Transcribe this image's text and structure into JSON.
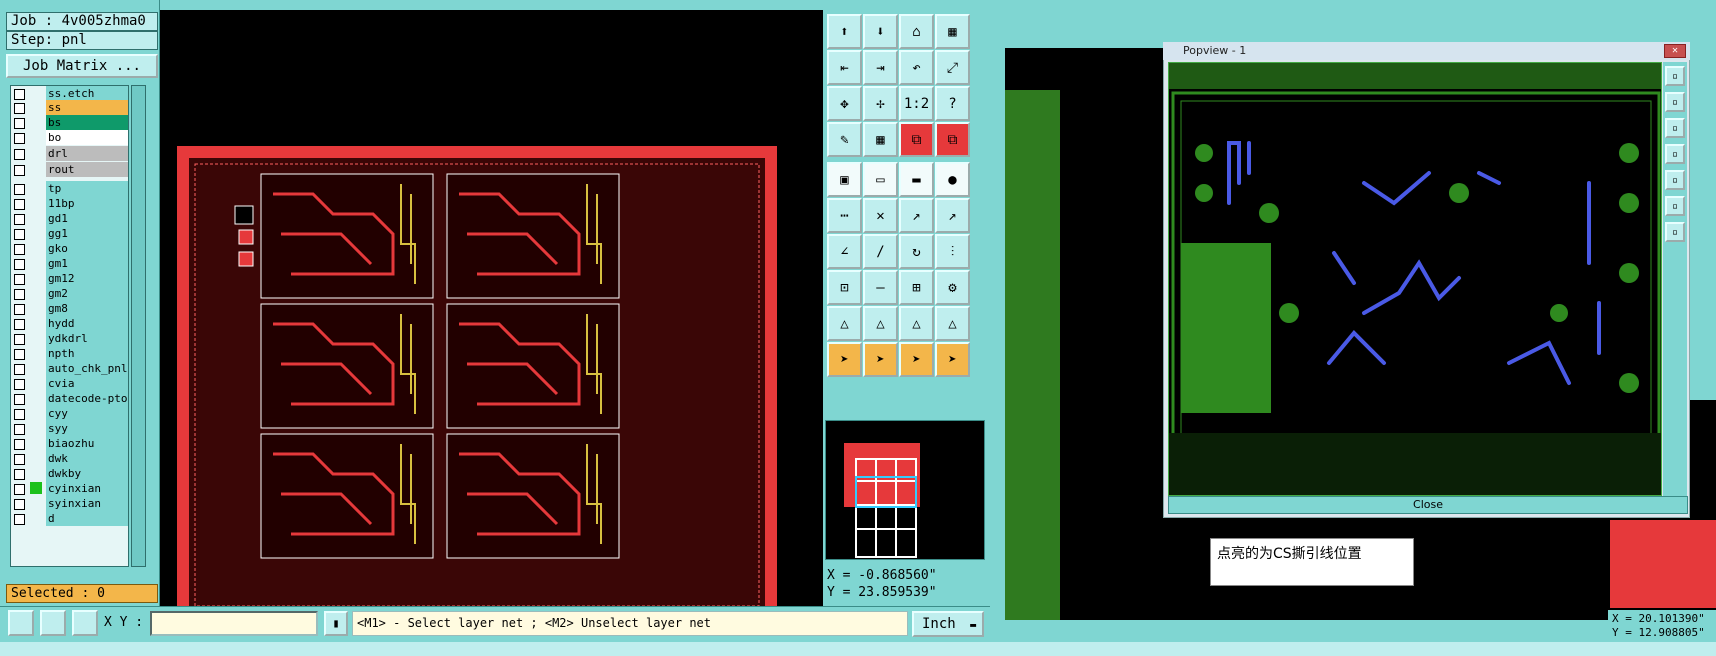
{
  "left_panel": {
    "job": "Job : 4v005zhma0",
    "step": "Step: pnl",
    "job_matrix_label": "Job Matrix ...",
    "layers": [
      {
        "name": "ss.etch",
        "swatch": ""
      },
      {
        "name": "ss",
        "swatch": "#f3b64a"
      },
      {
        "name": "bs",
        "swatch": "#0f9a6a"
      },
      {
        "name": "bo",
        "swatch": "#ffffff"
      },
      {
        "name": "drl",
        "swatch": "#bcbcbc"
      },
      {
        "name": "rout",
        "swatch": "#bcbcbc"
      },
      {
        "name": "tp",
        "swatch": ""
      },
      {
        "name": "11bp",
        "swatch": ""
      },
      {
        "name": "gd1",
        "swatch": ""
      },
      {
        "name": "gg1",
        "swatch": ""
      },
      {
        "name": "gko",
        "swatch": ""
      },
      {
        "name": "gm1",
        "swatch": ""
      },
      {
        "name": "gm12",
        "swatch": ""
      },
      {
        "name": "gm2",
        "swatch": ""
      },
      {
        "name": "gm8",
        "swatch": ""
      },
      {
        "name": "hydd",
        "swatch": ""
      },
      {
        "name": "ydkdrl",
        "swatch": ""
      },
      {
        "name": "npth",
        "swatch": ""
      },
      {
        "name": "auto_chk_pnl",
        "swatch": ""
      },
      {
        "name": "cvia",
        "swatch": ""
      },
      {
        "name": "datecode-pto",
        "swatch": ""
      },
      {
        "name": "cyy",
        "swatch": ""
      },
      {
        "name": "syy",
        "swatch": ""
      },
      {
        "name": "biaozhu",
        "swatch": ""
      },
      {
        "name": "dwk",
        "swatch": ""
      },
      {
        "name": "dwkby",
        "swatch": ""
      },
      {
        "name": "cyinxian",
        "swatch": "",
        "highlight": "#1cc11c"
      },
      {
        "name": "syinxian",
        "swatch": ""
      },
      {
        "name": "d",
        "swatch": ""
      }
    ],
    "selected": "Selected : 0"
  },
  "palette": {
    "coords_x": "X = -0.868560\"",
    "coords_y": "Y = 23.859539\""
  },
  "statusbar": {
    "xy_label": "X Y :",
    "xy_value": "",
    "hint": "<M1> - Select layer net ; <M2> Unselect layer net",
    "units": "Inch",
    "units_arrow": "▬"
  },
  "popup": {
    "title": "Popview - 1",
    "close_label": "Close"
  },
  "annotation": "点亮的为CS撕引线位置",
  "right_coords": {
    "x": "X = 20.101390\"",
    "y": "Y = 12.908805\""
  },
  "colors": {
    "panel": "#7fd6d2",
    "layer_red": "#e6393b",
    "pcb_green": "#2f8a1f",
    "highlight_blue": "#4a5ae6"
  }
}
